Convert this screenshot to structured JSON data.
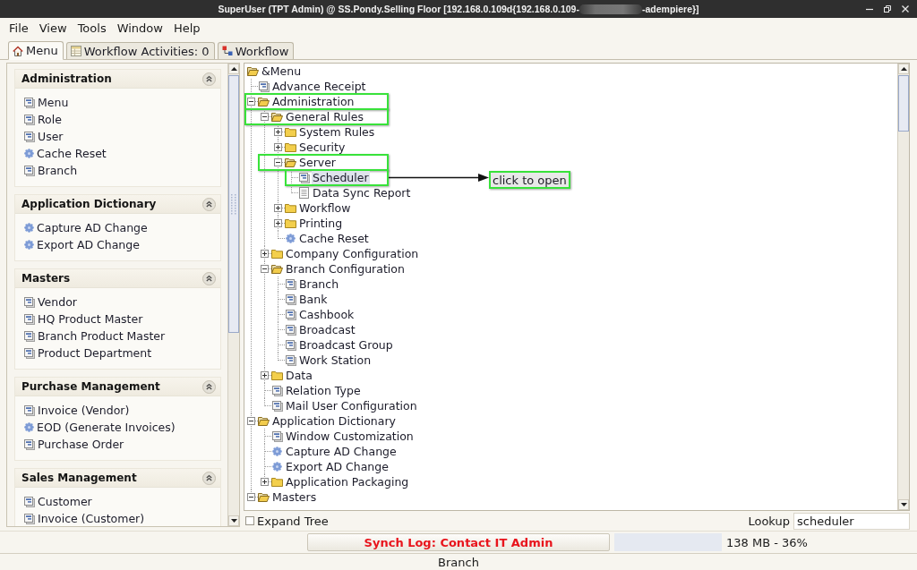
{
  "window": {
    "title": "SuperUser (TPT Admin) @ SS.Pondy.Selling Floor [192.168.0.109d{192.168.0.109-",
    "title_after_redaction": "-adempiere}]"
  },
  "menu_bar": [
    "File",
    "View",
    "Tools",
    "Window",
    "Help"
  ],
  "tabs": [
    {
      "label": "Menu",
      "kind": "home",
      "selected": true
    },
    {
      "label": "Workflow Activities: 0",
      "kind": "activities",
      "selected": false
    },
    {
      "label": "Workflow",
      "kind": "workflow",
      "selected": false
    }
  ],
  "task_groups": [
    {
      "title": "Administration",
      "expanded": true,
      "items": [
        {
          "label": "Menu",
          "kind": "window"
        },
        {
          "label": "Role",
          "kind": "window"
        },
        {
          "label": "User",
          "kind": "window"
        },
        {
          "label": "Cache Reset",
          "kind": "process"
        },
        {
          "label": "Branch",
          "kind": "window"
        }
      ]
    },
    {
      "title": "Application Dictionary",
      "expanded": true,
      "items": [
        {
          "label": "Capture AD Change",
          "kind": "process"
        },
        {
          "label": "Export AD Change",
          "kind": "process"
        }
      ]
    },
    {
      "title": "Masters",
      "expanded": true,
      "items": [
        {
          "label": "Vendor",
          "kind": "window"
        },
        {
          "label": "HQ Product Master",
          "kind": "window"
        },
        {
          "label": "Branch Product Master",
          "kind": "window"
        },
        {
          "label": "Product Department",
          "kind": "window"
        }
      ]
    },
    {
      "title": "Purchase Management",
      "expanded": true,
      "items": [
        {
          "label": "Invoice (Vendor)",
          "kind": "window"
        },
        {
          "label": "EOD (Generate Invoices)",
          "kind": "process"
        },
        {
          "label": "Purchase Order",
          "kind": "window"
        }
      ]
    },
    {
      "title": "Sales Management",
      "expanded": true,
      "items": [
        {
          "label": "Customer",
          "kind": "window"
        },
        {
          "label": "Invoice (Customer)",
          "kind": "window"
        }
      ]
    }
  ],
  "tree": {
    "root": {
      "label": "&Menu",
      "kind": "folder",
      "expanded": true,
      "selected": false,
      "highlighted": false,
      "children": [
        {
          "label": "Advance Receipt",
          "kind": "window",
          "selected": false,
          "highlighted": false
        },
        {
          "label": "Administration",
          "kind": "folder",
          "expanded": true,
          "selected": false,
          "highlighted": true,
          "children": [
            {
              "label": "General Rules",
              "kind": "folder",
              "expanded": true,
              "selected": false,
              "highlighted": true,
              "children": [
                {
                  "label": "System Rules",
                  "kind": "folder",
                  "expanded": false,
                  "selected": false,
                  "highlighted": false
                },
                {
                  "label": "Security",
                  "kind": "folder",
                  "expanded": false,
                  "selected": false,
                  "highlighted": false
                },
                {
                  "label": "Server",
                  "kind": "folder",
                  "expanded": true,
                  "selected": false,
                  "highlighted": true,
                  "children": [
                    {
                      "label": "Scheduler",
                      "kind": "window",
                      "selected": true,
                      "highlighted": true,
                      "callout": "click to open"
                    },
                    {
                      "label": "Data Sync Report",
                      "kind": "report",
                      "selected": false,
                      "highlighted": false
                    }
                  ]
                },
                {
                  "label": "Workflow",
                  "kind": "folder",
                  "expanded": false,
                  "selected": false,
                  "highlighted": false
                },
                {
                  "label": "Printing",
                  "kind": "folder",
                  "expanded": false,
                  "selected": false,
                  "highlighted": false
                },
                {
                  "label": "Cache Reset",
                  "kind": "process",
                  "selected": false,
                  "highlighted": false
                }
              ]
            },
            {
              "label": "Company Configuration",
              "kind": "folder",
              "expanded": false,
              "selected": false,
              "highlighted": false
            },
            {
              "label": "Branch Configuration",
              "kind": "folder",
              "expanded": true,
              "selected": false,
              "highlighted": false,
              "children": [
                {
                  "label": "Branch",
                  "kind": "window",
                  "selected": false,
                  "highlighted": false
                },
                {
                  "label": "Bank",
                  "kind": "window",
                  "selected": false,
                  "highlighted": false
                },
                {
                  "label": "Cashbook",
                  "kind": "window",
                  "selected": false,
                  "highlighted": false
                },
                {
                  "label": "Broadcast",
                  "kind": "window",
                  "selected": false,
                  "highlighted": false
                },
                {
                  "label": "Broadcast Group",
                  "kind": "window",
                  "selected": false,
                  "highlighted": false
                },
                {
                  "label": "Work Station",
                  "kind": "window",
                  "selected": false,
                  "highlighted": false
                }
              ]
            },
            {
              "label": "Data",
              "kind": "folder",
              "expanded": false,
              "selected": false,
              "highlighted": false
            },
            {
              "label": "Relation Type",
              "kind": "window",
              "selected": false,
              "highlighted": false
            },
            {
              "label": "Mail User Configuration",
              "kind": "window",
              "selected": false,
              "highlighted": false
            }
          ]
        },
        {
          "label": "Application Dictionary",
          "kind": "folder",
          "expanded": true,
          "selected": false,
          "highlighted": false,
          "children": [
            {
              "label": "Window Customization",
              "kind": "window",
              "selected": false,
              "highlighted": false
            },
            {
              "label": "Capture AD Change",
              "kind": "process",
              "selected": false,
              "highlighted": false
            },
            {
              "label": "Export AD Change",
              "kind": "process",
              "selected": false,
              "highlighted": false
            },
            {
              "label": "Application Packaging",
              "kind": "folder",
              "expanded": false,
              "selected": false,
              "highlighted": false
            }
          ]
        },
        {
          "label": "Masters",
          "kind": "folder",
          "expanded": true,
          "selected": false,
          "highlighted": false
        }
      ]
    }
  },
  "expand_tree": {
    "label": "Expand Tree",
    "checked": false
  },
  "lookup": {
    "label": "Lookup",
    "value": "scheduler"
  },
  "status_bar": {
    "sync_message": "Synch Log: Contact IT Admin",
    "memory": "138 MB - 36%"
  },
  "footer": {
    "context": "Branch"
  }
}
